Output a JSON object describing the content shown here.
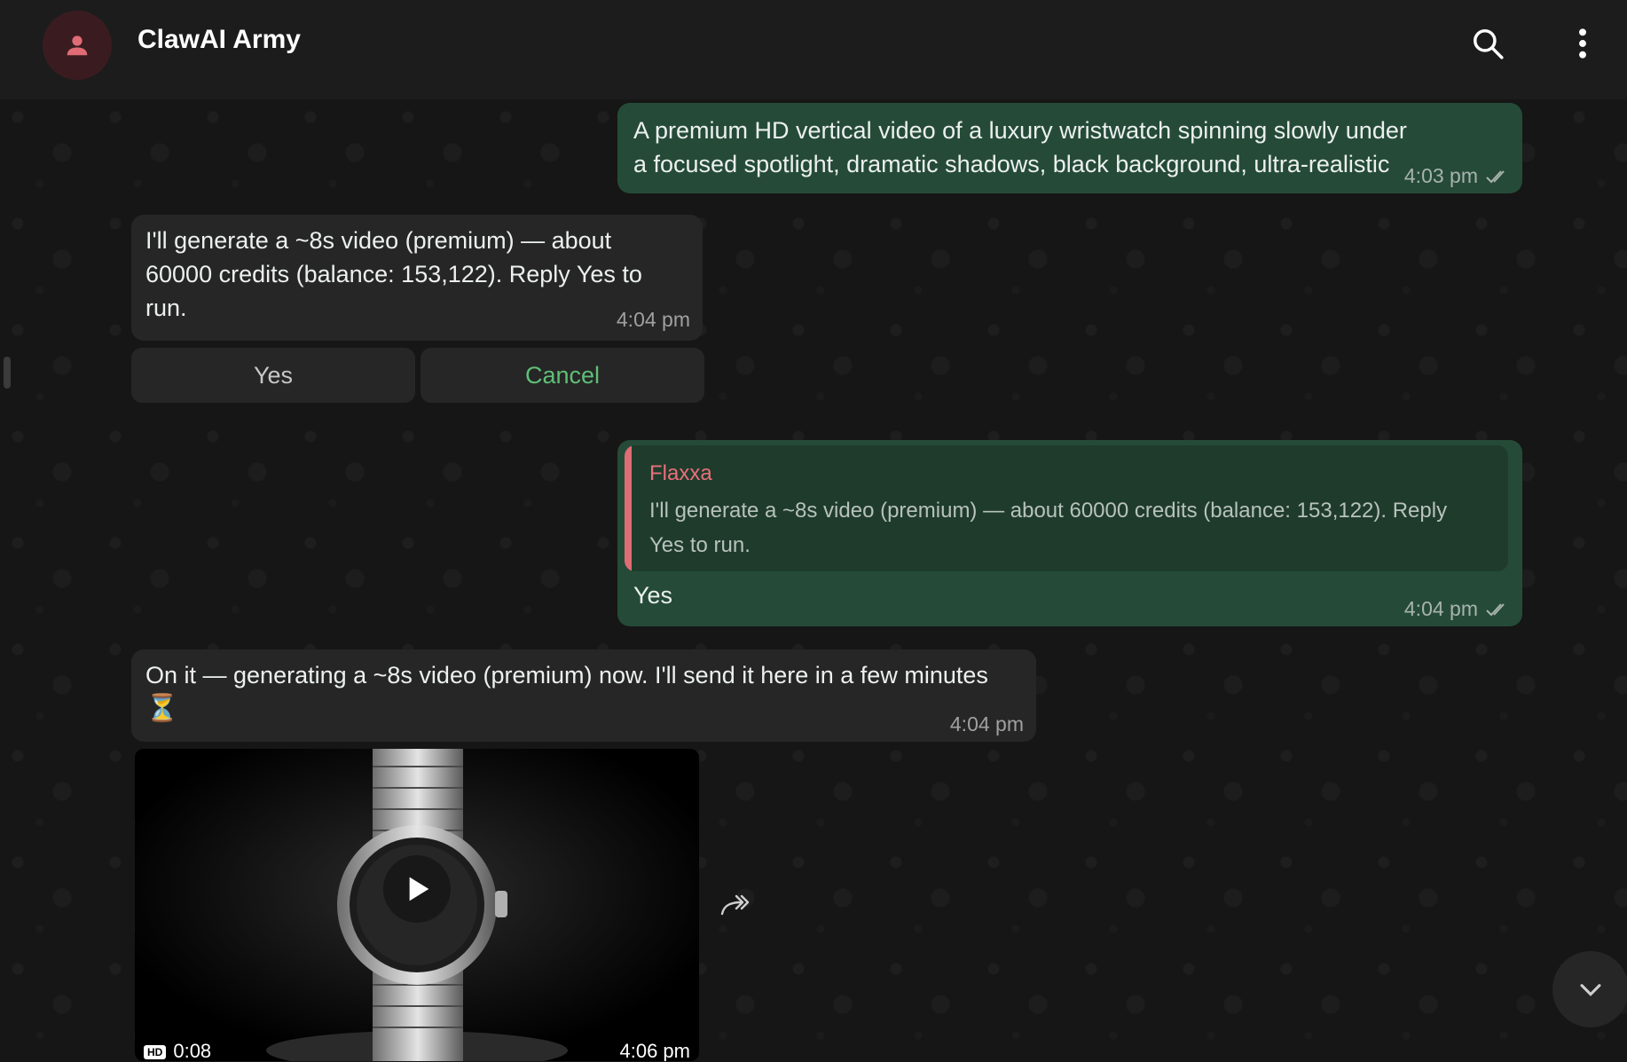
{
  "header": {
    "title": "ClawAI Army",
    "avatar_color": "#e06c75"
  },
  "messages": {
    "m1": {
      "text": "A premium HD vertical video of a luxury wristwatch spinning slowly under a focused spotlight, dramatic shadows, black background, ultra-realistic",
      "time": "4:03 pm"
    },
    "m2": {
      "text": "I'll generate a ~8s video (premium) — about 60000 credits (balance: 153,122). Reply Yes to run.",
      "time": "4:04 pm",
      "buttons": {
        "yes": "Yes",
        "cancel": "Cancel"
      }
    },
    "m3": {
      "quote_author": "Flaxxa",
      "quote_text": "I'll generate a ~8s video (premium) — about 60000 credits (balance: 153,122). Reply Yes to run.",
      "text": "Yes",
      "time": "4:04 pm"
    },
    "m4": {
      "text": "On it — generating a ~8s video (premium) now. I'll send it here in a few minutes",
      "emoji": "⏳",
      "time": "4:04 pm"
    },
    "m5": {
      "badge": "HD",
      "duration": "0:08",
      "time": "4:06 pm"
    }
  },
  "colors": {
    "outgoing_bubble": "#254b38",
    "incoming_bubble": "#262626",
    "cancel_text": "#5fbf77",
    "quote_accent": "#e06c75"
  },
  "icons": [
    "person-icon",
    "search-icon",
    "more-vert-icon",
    "double-check-icon",
    "forward-icon",
    "play-icon",
    "chevron-down-icon"
  ]
}
